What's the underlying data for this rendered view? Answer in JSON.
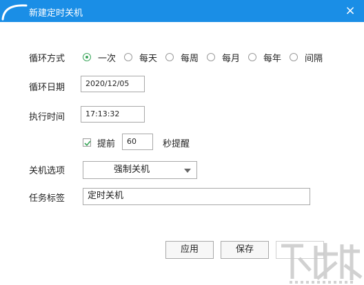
{
  "window": {
    "title": "新建定时关机",
    "close_glyph": "×"
  },
  "form": {
    "loop_mode_label": "循环方式",
    "loop_options": [
      "一次",
      "每天",
      "每周",
      "每月",
      "每年",
      "间隔"
    ],
    "loop_selected": "一次",
    "loop_date_label": "循环日期",
    "loop_date_value": "2020/12/05",
    "exec_time_label": "执行时间",
    "exec_time_value": "17:13:32",
    "advance_checked": true,
    "advance_label": "提前",
    "advance_value": "60",
    "advance_suffix": "秒提醒",
    "shutdown_option_label": "关机选项",
    "shutdown_option_value": "强制关机",
    "task_label_label": "任务标签",
    "task_label_value": "定时关机"
  },
  "buttons": {
    "apply": "应用",
    "save": "保存"
  },
  "colors": {
    "titlebar": "#1a8ee6",
    "radio_checked": "#3aa55a",
    "checkbox_check": "#3aa55a"
  },
  "icons": {
    "logo": "app-logo-icon",
    "close": "close-icon",
    "caret": "chevron-down-icon",
    "check": "check-icon"
  }
}
